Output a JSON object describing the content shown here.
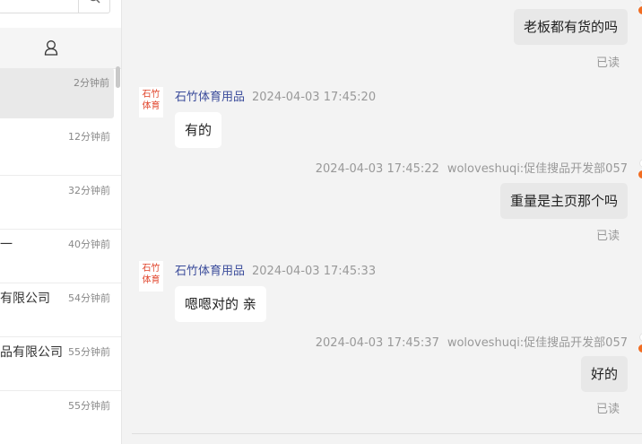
{
  "sidebar": {
    "search_icon": "search-icon",
    "contacts_icon": "contact-icon",
    "conversations": [
      {
        "name": "",
        "time": "2分钟前"
      },
      {
        "name": "",
        "time": "12分钟前"
      },
      {
        "name": "",
        "time": "32分钟前"
      },
      {
        "name": "一",
        "time": "40分钟前"
      },
      {
        "name": "有限公司",
        "time": "54分钟前"
      },
      {
        "name": "品有限公司",
        "time": "55分钟前"
      },
      {
        "name": "",
        "time": "55分钟前"
      }
    ]
  },
  "chat": {
    "avatar_text_line1": "石竹",
    "avatar_text_line2": "体育",
    "messages": [
      {
        "direction": "out",
        "text": "老板都有货的吗",
        "status": "已读"
      },
      {
        "direction": "in",
        "sender": "石竹体育用品",
        "time": "2024-04-03 17:45:20",
        "text": "有的"
      },
      {
        "direction": "out",
        "time": "2024-04-03 17:45:22",
        "sender": "woloveshuqi:促佳搜品开发部057",
        "text": "重量是主页那个吗",
        "status": "已读"
      },
      {
        "direction": "in",
        "sender": "石竹体育用品",
        "time": "2024-04-03 17:45:33",
        "text": "嗯嗯对的 亲"
      },
      {
        "direction": "out",
        "time": "2024-04-03 17:45:37",
        "sender": "woloveshuqi:促佳搜品开发部057",
        "text": "好的",
        "status": "已读"
      }
    ]
  },
  "colors": {
    "sender_name": "#3b4c9b",
    "avatar_text": "#e0432a",
    "status_dot": "#f26d22"
  }
}
